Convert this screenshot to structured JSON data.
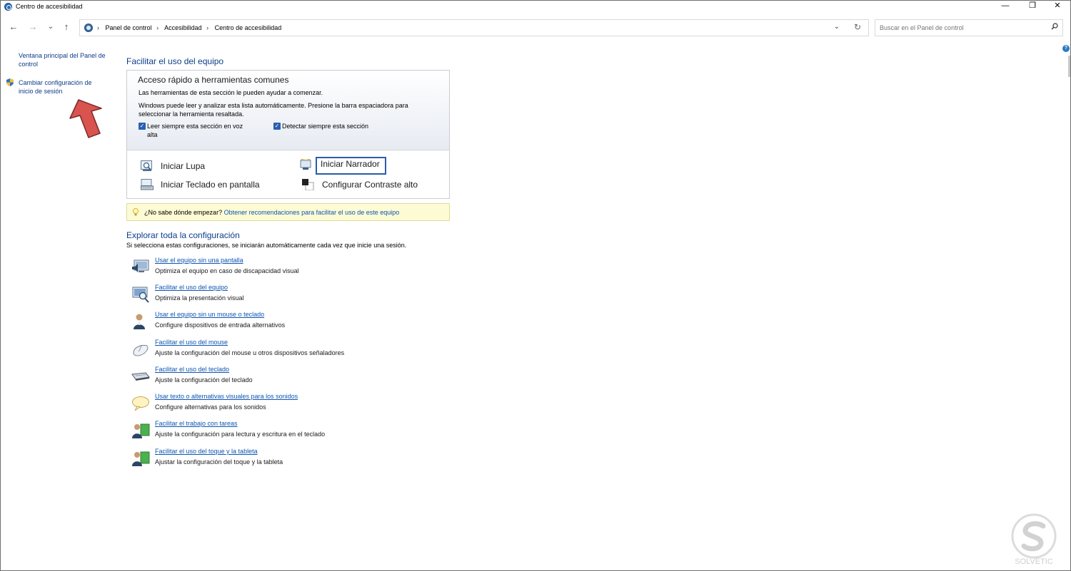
{
  "window": {
    "title": "Centro de accesibilidad",
    "controls": {
      "minimize": "—",
      "restore": "❐",
      "close": "✕"
    }
  },
  "navigation": {
    "back": "←",
    "forward": "→",
    "recent": "⌄",
    "up": "↑",
    "breadcrumbs": [
      "Panel de control",
      "Accesibilidad",
      "Centro de accesibilidad"
    ],
    "dropdown": "⌄",
    "refresh": "↻"
  },
  "search": {
    "placeholder": "Buscar en el Panel de control",
    "icon": "search-icon"
  },
  "help": "?",
  "sidebar": {
    "items": [
      {
        "label": "Ventana principal del Panel de control"
      },
      {
        "label": "Cambiar configuración de inicio de sesión",
        "icon": "uac-shield-icon"
      }
    ]
  },
  "main": {
    "heading": "Facilitar el uso del equipo",
    "quick_access": {
      "title": "Acceso rápido a herramientas comunes",
      "line1": "Las herramientas de esta sección le pueden ayudar a comenzar.",
      "line2": "Windows puede leer y analizar esta lista automáticamente. Presione la barra espaciadora para seleccionar la herramienta resaltada.",
      "checkbox_read": {
        "label": "Leer siempre esta sección en voz alta",
        "checked": true
      },
      "checkbox_detect": {
        "label": "Detectar siempre esta sección",
        "checked": true
      },
      "tools": [
        {
          "label": "Iniciar Lupa",
          "icon": "magnifier-icon"
        },
        {
          "label": "Iniciar Narrador",
          "icon": "narrator-icon",
          "focused": true
        },
        {
          "label": "Iniciar Teclado en pantalla",
          "icon": "on-screen-keyboard-icon"
        },
        {
          "label": "Configurar Contraste alto",
          "icon": "high-contrast-icon"
        }
      ]
    },
    "tip": {
      "question": "¿No sabe dónde empezar?",
      "link": "Obtener recomendaciones para facilitar el uso de este equipo"
    },
    "explore": {
      "heading": "Explorar toda la configuración",
      "subtitle": "Si selecciona estas configuraciones, se iniciarán automáticamente cada vez que inicie una sesión.",
      "items": [
        {
          "link": "Usar el equipo sin una pantalla",
          "desc": "Optimiza el equipo en caso de discapacidad visual",
          "icon": "monitor-speaker-icon"
        },
        {
          "link": "Facilitar el uso del equipo",
          "desc": "Optimiza la presentación visual",
          "icon": "monitor-magnifier-icon"
        },
        {
          "link": "Usar el equipo sin un mouse o teclado",
          "desc": "Configure dispositivos de entrada alternativos",
          "icon": "person-speech-icon"
        },
        {
          "link": "Facilitar el uso del mouse",
          "desc": "Ajuste la configuración del mouse u otros dispositivos señaladores",
          "icon": "mouse-icon"
        },
        {
          "link": "Facilitar el uso del teclado",
          "desc": "Ajuste la configuración del teclado",
          "icon": "keyboard-icon"
        },
        {
          "link": "Usar texto o alternativas visuales para los sonidos",
          "desc": "Configure alternativas para los sonidos",
          "icon": "speech-bubble-icon"
        },
        {
          "link": "Facilitar el trabajo con tareas",
          "desc": "Ajuste la configuración para lectura y escritura en el teclado",
          "icon": "person-board-icon"
        },
        {
          "link": "Facilitar el uso del toque y la tableta",
          "desc": "Ajustar la configuración del toque y la tableta",
          "icon": "person-tablet-icon"
        }
      ]
    }
  }
}
